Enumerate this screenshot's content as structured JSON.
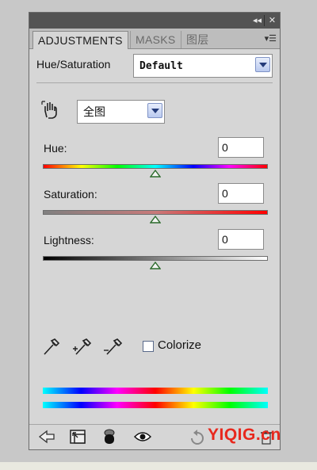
{
  "panel": {
    "tabs": [
      {
        "label": "ADJUSTMENTS",
        "active": true
      },
      {
        "label": "MASKS",
        "active": false
      },
      {
        "label": "图层",
        "active": false
      }
    ]
  },
  "adjustment": {
    "title": "Hue/Saturation",
    "preset_value": "Default",
    "channel_value": "全图"
  },
  "sliders": [
    {
      "label": "Hue:",
      "value": "0",
      "position": 0.5
    },
    {
      "label": "Saturation:",
      "value": "0",
      "position": 0.5
    },
    {
      "label": "Lightness:",
      "value": "0",
      "position": 0.5
    }
  ],
  "colorize": {
    "label": "Colorize",
    "checked": false
  },
  "icons": {
    "on_image_adjust": "hand-target-icon",
    "eyedropper": "eyedropper-icon",
    "eyedropper_add": "eyedropper-plus-icon",
    "eyedropper_subtract": "eyedropper-minus-icon",
    "back": "arrow-left-icon",
    "expand_view": "expand-view-icon",
    "clip_layer": "clip-layer-icon",
    "visibility": "eye-icon",
    "reset": "reset-icon",
    "delete": "trash-icon"
  },
  "colors": {
    "accent": "#7f93c6",
    "watermark": "#e8281d"
  },
  "watermark": "YIQIG.cn"
}
